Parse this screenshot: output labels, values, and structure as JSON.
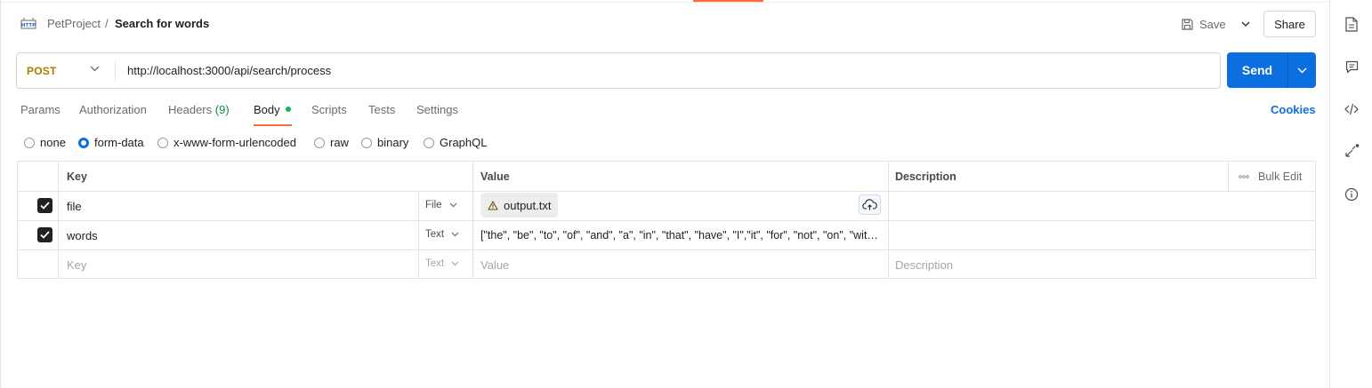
{
  "breadcrumb": {
    "project": "PetProject",
    "separator": "/",
    "title": "Search for words"
  },
  "header": {
    "save_label": "Save",
    "share_label": "Share"
  },
  "request": {
    "method": "POST",
    "url": "http://localhost:3000/api/search/process",
    "send_label": "Send"
  },
  "tabs": {
    "params": "Params",
    "authorization": "Authorization",
    "headers": "Headers",
    "headers_count": "(9)",
    "body": "Body",
    "scripts": "Scripts",
    "tests": "Tests",
    "settings": "Settings"
  },
  "cookies_label": "Cookies",
  "body_types": {
    "none": "none",
    "form_data": "form-data",
    "urlencoded": "x-www-form-urlencoded",
    "raw": "raw",
    "binary": "binary",
    "graphql": "GraphQL",
    "selected": "form-data"
  },
  "table": {
    "headers": {
      "key": "Key",
      "value": "Value",
      "description": "Description",
      "bulk_edit": "Bulk Edit"
    },
    "rows": [
      {
        "checked": true,
        "key": "file",
        "type": "File",
        "value": "output.txt",
        "description": ""
      },
      {
        "checked": true,
        "key": "words",
        "type": "Text",
        "value": "[\"the\", \"be\", \"to\", \"of\", \"and\", \"a\", \"in\", \"that\", \"have\", \"I\",\"it\", \"for\", \"not\", \"on\", \"wit…",
        "description": ""
      }
    ],
    "placeholder": {
      "key": "Key",
      "type": "Text",
      "value": "Value",
      "description": "Description"
    }
  },
  "colors": {
    "accent": "#ff6c37",
    "primary": "#0b6fe0",
    "method": "#ad7a03",
    "body_dot": "#0cbb52",
    "headers_count": "#0f8a47"
  }
}
